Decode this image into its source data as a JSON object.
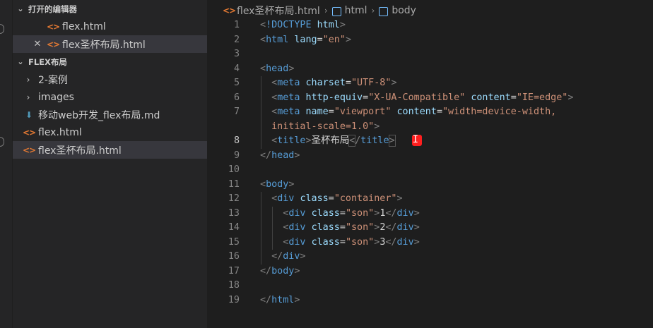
{
  "sidebar": {
    "open_editors_title": "打开的编辑器",
    "open_editors": [
      {
        "label": "flex.html",
        "close": ""
      },
      {
        "label": "flex圣杯布局.html",
        "close": "✕"
      }
    ],
    "project_title": "FLEX布局",
    "items": [
      {
        "label": "2-案例",
        "kind": "folder"
      },
      {
        "label": "images",
        "kind": "folder"
      },
      {
        "label": "移动web开发_flex布局.md",
        "kind": "md"
      },
      {
        "label": "flex.html",
        "kind": "html"
      },
      {
        "label": "flex圣杯布局.html",
        "kind": "html"
      }
    ]
  },
  "breadcrumb": {
    "file": "flex圣杯布局.html",
    "node1": "html",
    "node2": "body"
  },
  "code": {
    "line_numbers": [
      "1",
      "2",
      "3",
      "4",
      "5",
      "6",
      "7",
      "",
      "8",
      "9",
      "10",
      "11",
      "12",
      "13",
      "14",
      "15",
      "16",
      "17",
      "18",
      "19"
    ],
    "active_line": "8",
    "title_text": "圣杯布局",
    "charset": "\"UTF-8\"",
    "compat": "\"X-UA-Compatible\"",
    "ie_edge": "\"IE=edge\"",
    "viewport": "\"viewport\"",
    "viewport_content_1": "\"width=device-width,",
    "viewport_content_2": "initial-scale=1.0\"",
    "lang": "\"en\"",
    "container": "\"container\"",
    "son": "\"son\"",
    "son_values": [
      "1",
      "2",
      "3"
    ]
  }
}
